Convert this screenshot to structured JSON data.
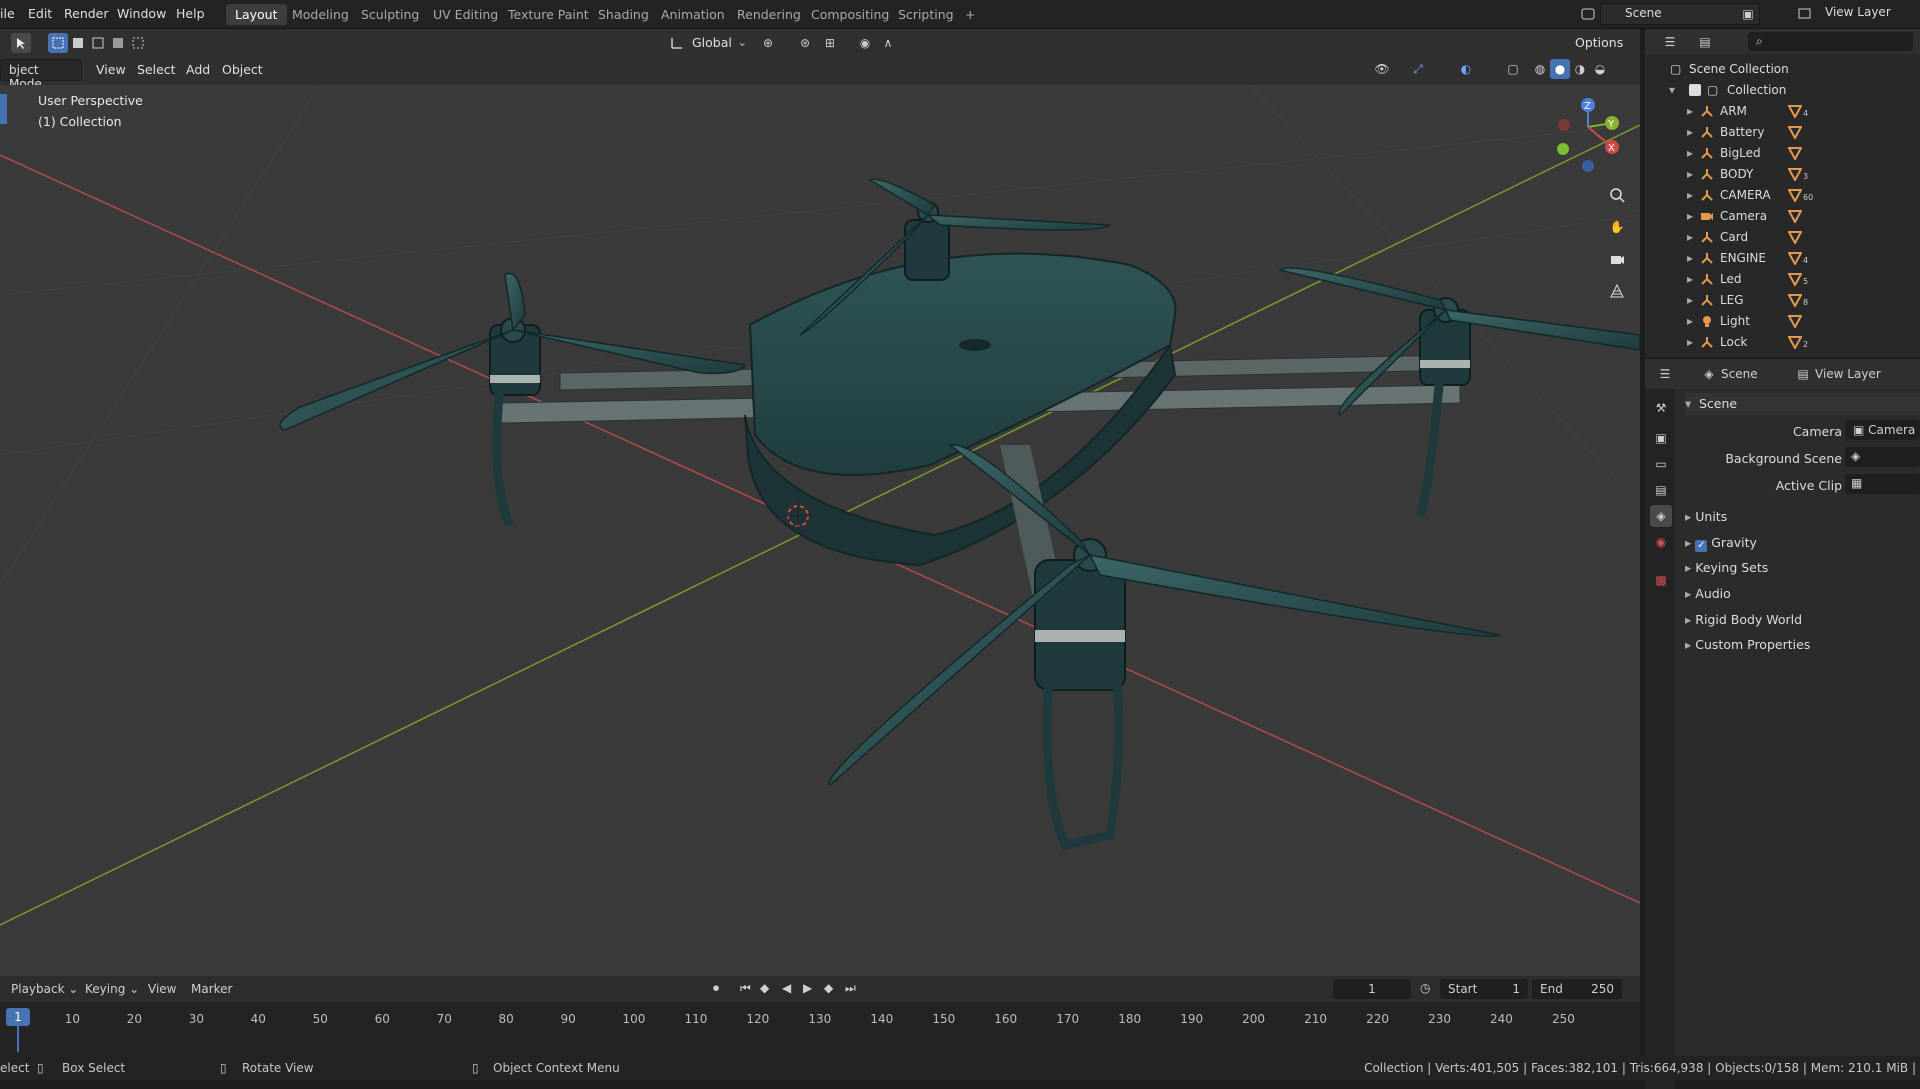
{
  "menu": [
    "ile",
    "Edit",
    "Render",
    "Window",
    "Help"
  ],
  "workspaces": [
    "Layout",
    "Modeling",
    "Sculpting",
    "UV Editing",
    "Texture Paint",
    "Shading",
    "Animation",
    "Rendering",
    "Compositing",
    "Scripting",
    "+"
  ],
  "top_right": {
    "scene": "Scene",
    "view_layer": "View Layer"
  },
  "header": {
    "mode": "bject Mode",
    "menus": [
      "View",
      "Select",
      "Add",
      "Object"
    ],
    "transform_orientation": "Global",
    "options": "Options"
  },
  "viewport": {
    "perspective": "User Perspective",
    "collection": "(1) Collection",
    "gizmo_axes": [
      "Z",
      "Y",
      "X"
    ]
  },
  "outliner": {
    "root": "Scene Collection",
    "collection": "Collection",
    "items": [
      {
        "name": "ARM",
        "icon": "armature-icon",
        "mesh_count": "4"
      },
      {
        "name": "Battery",
        "icon": "armature-icon",
        "mesh_count": ""
      },
      {
        "name": "BigLed",
        "icon": "armature-icon",
        "mesh_count": ""
      },
      {
        "name": "BODY",
        "icon": "armature-icon",
        "mesh_count": "3"
      },
      {
        "name": "CAMERA",
        "icon": "armature-icon",
        "mesh_count": "60"
      },
      {
        "name": "Camera",
        "icon": "camera-icon",
        "mesh_count": ""
      },
      {
        "name": "Card",
        "icon": "armature-icon",
        "mesh_count": ""
      },
      {
        "name": "ENGINE",
        "icon": "armature-icon",
        "mesh_count": "4"
      },
      {
        "name": "Led",
        "icon": "armature-icon",
        "mesh_count": "5"
      },
      {
        "name": "LEG",
        "icon": "armature-icon",
        "mesh_count": "8"
      },
      {
        "name": "Light",
        "icon": "light-icon",
        "mesh_count": ""
      },
      {
        "name": "Lock",
        "icon": "armature-icon",
        "mesh_count": "2"
      }
    ]
  },
  "properties": {
    "header_scene": "Scene",
    "header_view_layer": "View Layer",
    "panel_title": "Scene",
    "camera_label": "Camera",
    "camera_value": "Camera",
    "background_scene_label": "Background Scene",
    "active_clip_label": "Active Clip",
    "subpanels": [
      "Units",
      "Gravity",
      "Keying Sets",
      "Audio",
      "Rigid Body World",
      "Custom Properties"
    ],
    "gravity_checked": true
  },
  "timeline": {
    "menus": [
      "Playback",
      "Keying",
      "View",
      "Marker"
    ],
    "current_frame": "1",
    "start_label": "Start",
    "start_value": "1",
    "end_label": "End",
    "end_value": "250",
    "ticks": [
      "1",
      "10",
      "20",
      "30",
      "40",
      "50",
      "60",
      "70",
      "80",
      "90",
      "100",
      "110",
      "120",
      "130",
      "140",
      "150",
      "160",
      "170",
      "180",
      "190",
      "200",
      "210",
      "220",
      "230",
      "240",
      "250"
    ]
  },
  "status": {
    "select": "elect",
    "box_select": "Box Select",
    "rotate_view": "Rotate View",
    "context_menu": "Object Context Menu",
    "stats": "Collection | Verts:401,505 | Faces:382,101 | Tris:664,938 | Objects:0/158 | Mem: 210.1 MiB |"
  },
  "colors": {
    "accent": "#4772b3",
    "drone": "#2c4f51",
    "x_axis": "#d04848",
    "y_axis": "#8ab030",
    "z_axis": "#4a80d8"
  }
}
